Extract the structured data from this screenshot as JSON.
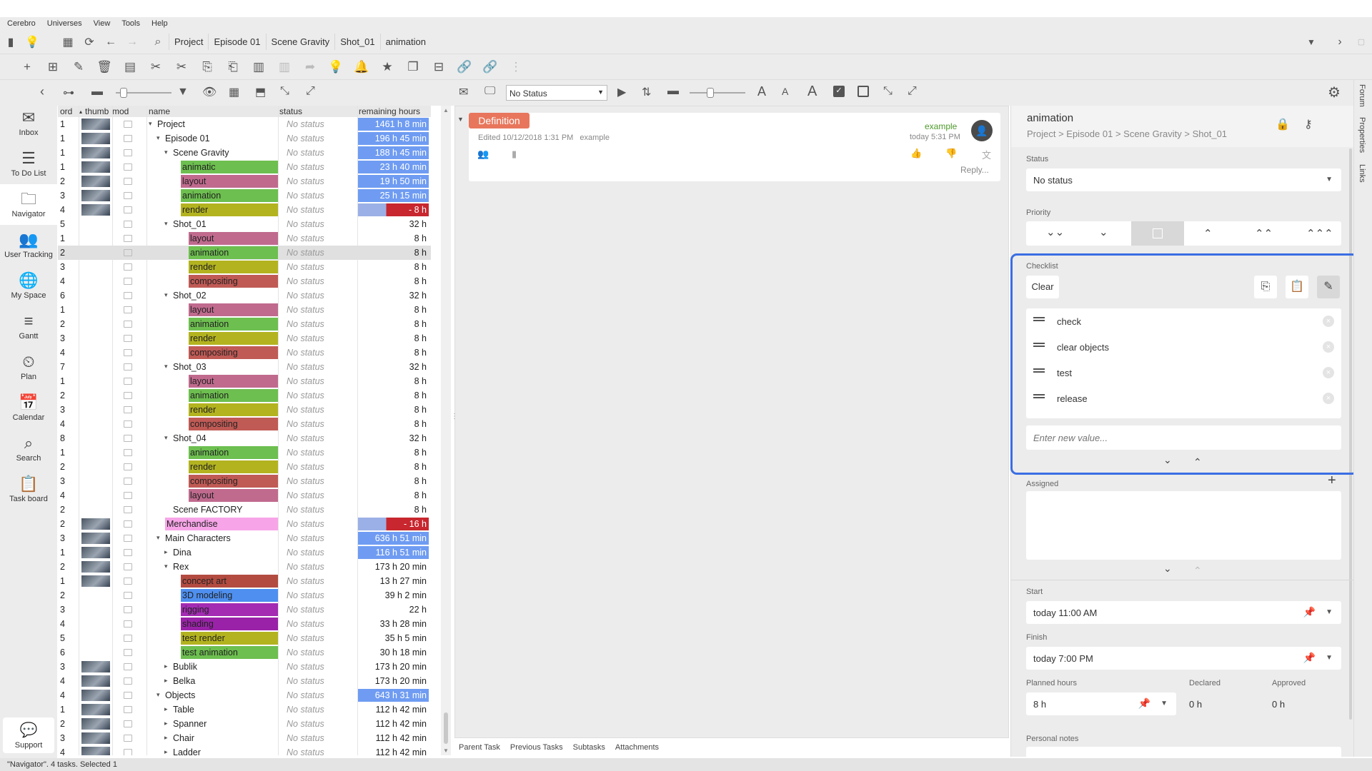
{
  "menu": [
    "Cerebro",
    "Universes",
    "View",
    "Tools",
    "Help"
  ],
  "breadcrumb": [
    "Project",
    "Episode 01",
    "Scene Gravity",
    "Shot_01",
    "animation"
  ],
  "sidebar": [
    {
      "label": "Inbox",
      "icon": "inbox-icon",
      "glyph": "✉"
    },
    {
      "label": "To Do List",
      "icon": "todo-list-icon",
      "glyph": "☰"
    },
    {
      "label": "Navigator",
      "icon": "folder-icon",
      "glyph": "🗀"
    },
    {
      "label": "User Tracking",
      "icon": "users-icon",
      "glyph": "👥"
    },
    {
      "label": "My Space",
      "icon": "globe-icon",
      "glyph": "🌐"
    },
    {
      "label": "Gantt",
      "icon": "gantt-icon",
      "glyph": "≡"
    },
    {
      "label": "Plan",
      "icon": "plan-icon",
      "glyph": "⏲"
    },
    {
      "label": "Calendar",
      "icon": "calendar-icon",
      "glyph": "📅"
    },
    {
      "label": "Search",
      "icon": "search-icon",
      "glyph": "⌕"
    },
    {
      "label": "Task board",
      "icon": "clipboard-icon",
      "glyph": "📋"
    }
  ],
  "support": "Support",
  "toolbar2": {
    "status_filter": "No Status"
  },
  "tree": {
    "headers": {
      "ord": "ord",
      "thumb": "thumb",
      "mod": "mod",
      "name": "name",
      "status": "status",
      "remaining": "remaining hours"
    },
    "rows": [
      {
        "ord": "1",
        "indent": 0,
        "tri": "▾",
        "name": "Project",
        "thumb": true,
        "color": "",
        "st": "No status",
        "rh": "1461 h 8 min",
        "bar": "blue"
      },
      {
        "ord": "1",
        "indent": 1,
        "tri": "▾",
        "name": "Episode 01",
        "thumb": true,
        "color": "",
        "st": "No status",
        "rh": "196 h 45 min",
        "bar": "blue"
      },
      {
        "ord": "1",
        "indent": 2,
        "tri": "▾",
        "name": "Scene Gravity",
        "thumb": true,
        "color": "",
        "st": "No status",
        "rh": "188 h 45 min",
        "bar": "blue"
      },
      {
        "ord": "1",
        "indent": 3,
        "tri": "",
        "name": "animatic",
        "thumb": true,
        "color": "#6dbf4f",
        "st": "No status",
        "rh": "23 h 40 min",
        "bar": "blue"
      },
      {
        "ord": "2",
        "indent": 3,
        "tri": "",
        "name": "layout",
        "thumb": true,
        "color": "#c06a8e",
        "st": "No status",
        "rh": "19 h 50 min",
        "bar": "blue"
      },
      {
        "ord": "3",
        "indent": 3,
        "tri": "",
        "name": "animation",
        "thumb": true,
        "color": "#6dbf4f",
        "st": "No status",
        "rh": "25 h 15 min",
        "bar": "blue"
      },
      {
        "ord": "4",
        "indent": 3,
        "tri": "",
        "name": "render",
        "thumb": true,
        "color": "#b3b320",
        "st": "No status",
        "rh": "- 8 h",
        "bar": "red"
      },
      {
        "ord": "5",
        "indent": 2,
        "tri": "▾",
        "name": "Shot_01",
        "thumb": false,
        "color": "",
        "st": "No status",
        "rh": "32 h",
        "bar": ""
      },
      {
        "ord": "1",
        "indent": 4,
        "tri": "",
        "name": "layout",
        "thumb": false,
        "color": "#c06a8e",
        "st": "No status",
        "rh": "8 h",
        "bar": ""
      },
      {
        "ord": "2",
        "indent": 4,
        "tri": "",
        "name": "animation",
        "thumb": false,
        "color": "#6dbf4f",
        "st": "No status",
        "rh": "8 h",
        "bar": "",
        "sel": true
      },
      {
        "ord": "3",
        "indent": 4,
        "tri": "",
        "name": "render",
        "thumb": false,
        "color": "#b3b320",
        "st": "No status",
        "rh": "8 h",
        "bar": ""
      },
      {
        "ord": "4",
        "indent": 4,
        "tri": "",
        "name": "compositing",
        "thumb": false,
        "color": "#c05a55",
        "st": "No status",
        "rh": "8 h",
        "bar": ""
      },
      {
        "ord": "6",
        "indent": 2,
        "tri": "▾",
        "name": "Shot_02",
        "thumb": false,
        "color": "",
        "st": "No status",
        "rh": "32 h",
        "bar": ""
      },
      {
        "ord": "1",
        "indent": 4,
        "tri": "",
        "name": "layout",
        "thumb": false,
        "color": "#c06a8e",
        "st": "No status",
        "rh": "8 h",
        "bar": ""
      },
      {
        "ord": "2",
        "indent": 4,
        "tri": "",
        "name": "animation",
        "thumb": false,
        "color": "#6dbf4f",
        "st": "No status",
        "rh": "8 h",
        "bar": ""
      },
      {
        "ord": "3",
        "indent": 4,
        "tri": "",
        "name": "render",
        "thumb": false,
        "color": "#b3b320",
        "st": "No status",
        "rh": "8 h",
        "bar": ""
      },
      {
        "ord": "4",
        "indent": 4,
        "tri": "",
        "name": "compositing",
        "thumb": false,
        "color": "#c05a55",
        "st": "No status",
        "rh": "8 h",
        "bar": ""
      },
      {
        "ord": "7",
        "indent": 2,
        "tri": "▾",
        "name": "Shot_03",
        "thumb": false,
        "color": "",
        "st": "No status",
        "rh": "32 h",
        "bar": ""
      },
      {
        "ord": "1",
        "indent": 4,
        "tri": "",
        "name": "layout",
        "thumb": false,
        "color": "#c06a8e",
        "st": "No status",
        "rh": "8 h",
        "bar": ""
      },
      {
        "ord": "2",
        "indent": 4,
        "tri": "",
        "name": "animation",
        "thumb": false,
        "color": "#6dbf4f",
        "st": "No status",
        "rh": "8 h",
        "bar": ""
      },
      {
        "ord": "3",
        "indent": 4,
        "tri": "",
        "name": "render",
        "thumb": false,
        "color": "#b3b320",
        "st": "No status",
        "rh": "8 h",
        "bar": ""
      },
      {
        "ord": "4",
        "indent": 4,
        "tri": "",
        "name": "compositing",
        "thumb": false,
        "color": "#c05a55",
        "st": "No status",
        "rh": "8 h",
        "bar": ""
      },
      {
        "ord": "8",
        "indent": 2,
        "tri": "▾",
        "name": "Shot_04",
        "thumb": false,
        "color": "",
        "st": "No status",
        "rh": "32 h",
        "bar": ""
      },
      {
        "ord": "1",
        "indent": 4,
        "tri": "",
        "name": "animation",
        "thumb": false,
        "color": "#6dbf4f",
        "st": "No status",
        "rh": "8 h",
        "bar": ""
      },
      {
        "ord": "2",
        "indent": 4,
        "tri": "",
        "name": "render",
        "thumb": false,
        "color": "#b3b320",
        "st": "No status",
        "rh": "8 h",
        "bar": ""
      },
      {
        "ord": "3",
        "indent": 4,
        "tri": "",
        "name": "compositing",
        "thumb": false,
        "color": "#c05a55",
        "st": "No status",
        "rh": "8 h",
        "bar": ""
      },
      {
        "ord": "4",
        "indent": 4,
        "tri": "",
        "name": "layout",
        "thumb": false,
        "color": "#c06a8e",
        "st": "No status",
        "rh": "8 h",
        "bar": ""
      },
      {
        "ord": "2",
        "indent": 2,
        "tri": "",
        "name": "Scene FACTORY",
        "thumb": false,
        "color": "",
        "st": "No status",
        "rh": "8 h",
        "bar": ""
      },
      {
        "ord": "2",
        "indent": 1,
        "tri": "",
        "name": "Merchandise",
        "thumb": true,
        "color": "#f7a5e8",
        "st": "No status",
        "rh": "- 16 h",
        "bar": "red"
      },
      {
        "ord": "3",
        "indent": 1,
        "tri": "▾",
        "name": "Main Characters",
        "thumb": true,
        "color": "",
        "st": "No status",
        "rh": "636 h 51 min",
        "bar": "blue"
      },
      {
        "ord": "1",
        "indent": 2,
        "tri": "▸",
        "name": "Dina",
        "thumb": true,
        "color": "",
        "st": "No status",
        "rh": "116 h 51 min",
        "bar": "blue"
      },
      {
        "ord": "2",
        "indent": 2,
        "tri": "▾",
        "name": "Rex",
        "thumb": true,
        "color": "",
        "st": "No status",
        "rh": "173 h 20 min",
        "bar": ""
      },
      {
        "ord": "1",
        "indent": 3,
        "tri": "",
        "name": "concept art",
        "thumb": true,
        "color": "#b34b40",
        "st": "No status",
        "rh": "13 h 27 min",
        "bar": ""
      },
      {
        "ord": "2",
        "indent": 3,
        "tri": "",
        "name": "3D modeling",
        "thumb": false,
        "color": "#4e8ff0",
        "st": "No status",
        "rh": "39 h 2 min",
        "bar": ""
      },
      {
        "ord": "3",
        "indent": 3,
        "tri": "",
        "name": "rigging",
        "thumb": false,
        "color": "#a32cb3",
        "st": "No status",
        "rh": "22 h",
        "bar": ""
      },
      {
        "ord": "4",
        "indent": 3,
        "tri": "",
        "name": "shading",
        "thumb": false,
        "color": "#9a22a8",
        "st": "No status",
        "rh": "33 h 28 min",
        "bar": ""
      },
      {
        "ord": "5",
        "indent": 3,
        "tri": "",
        "name": "test render",
        "thumb": false,
        "color": "#b3b320",
        "st": "No status",
        "rh": "35 h 5 min",
        "bar": ""
      },
      {
        "ord": "6",
        "indent": 3,
        "tri": "",
        "name": "test animation",
        "thumb": false,
        "color": "#6dbf4f",
        "st": "No status",
        "rh": "30 h 18 min",
        "bar": ""
      },
      {
        "ord": "3",
        "indent": 2,
        "tri": "▸",
        "name": "Bublik",
        "thumb": true,
        "color": "",
        "st": "No status",
        "rh": "173 h 20 min",
        "bar": ""
      },
      {
        "ord": "4",
        "indent": 2,
        "tri": "▸",
        "name": "Belka",
        "thumb": true,
        "color": "",
        "st": "No status",
        "rh": "173 h 20 min",
        "bar": ""
      },
      {
        "ord": "4",
        "indent": 1,
        "tri": "▾",
        "name": "Objects",
        "thumb": true,
        "color": "",
        "st": "No status",
        "rh": "643 h 31 min",
        "bar": "blue"
      },
      {
        "ord": "1",
        "indent": 2,
        "tri": "▸",
        "name": "Table",
        "thumb": true,
        "color": "",
        "st": "No status",
        "rh": "112 h 42 min",
        "bar": ""
      },
      {
        "ord": "2",
        "indent": 2,
        "tri": "▸",
        "name": "Spanner",
        "thumb": true,
        "color": "",
        "st": "No status",
        "rh": "112 h 42 min",
        "bar": ""
      },
      {
        "ord": "3",
        "indent": 2,
        "tri": "▸",
        "name": "Chair",
        "thumb": true,
        "color": "",
        "st": "No status",
        "rh": "112 h 42 min",
        "bar": ""
      },
      {
        "ord": "4",
        "indent": 2,
        "tri": "▸",
        "name": "Ladder",
        "thumb": true,
        "color": "",
        "st": "No status",
        "rh": "112 h 42 min",
        "bar": ""
      }
    ]
  },
  "feed": {
    "tag": "Definition",
    "edited": "Edited 10/12/2018 1:31 PM",
    "editor": "example",
    "author": "example",
    "time": "today 5:31 PM",
    "reply": "Reply...",
    "tabs": [
      "Parent Task",
      "Previous Tasks",
      "Subtasks",
      "Attachments"
    ]
  },
  "props": {
    "title": "animation",
    "path": "Project > Episode 01 > Scene Gravity > Shot_01",
    "status_label": "Status",
    "status_value": "No status",
    "priority_label": "Priority",
    "checklist_label": "Checklist",
    "clear": "Clear",
    "checklist": [
      "check",
      "clear objects",
      "test",
      "release"
    ],
    "new_value_placeholder": "Enter new value...",
    "assigned_label": "Assigned",
    "start_label": "Start",
    "start_value": "today 11:00 AM",
    "finish_label": "Finish",
    "finish_value": "today 7:00 PM",
    "planned_label": "Planned hours",
    "planned_value": "8 h",
    "declared_label": "Declared",
    "declared_value": "0 h",
    "approved_label": "Approved",
    "approved_value": "0 h",
    "notes_label": "Personal notes"
  },
  "right_tabs": [
    "Forum",
    "Properties",
    "Links"
  ],
  "status_text": "\"Navigator\". 4 tasks. Selected 1"
}
